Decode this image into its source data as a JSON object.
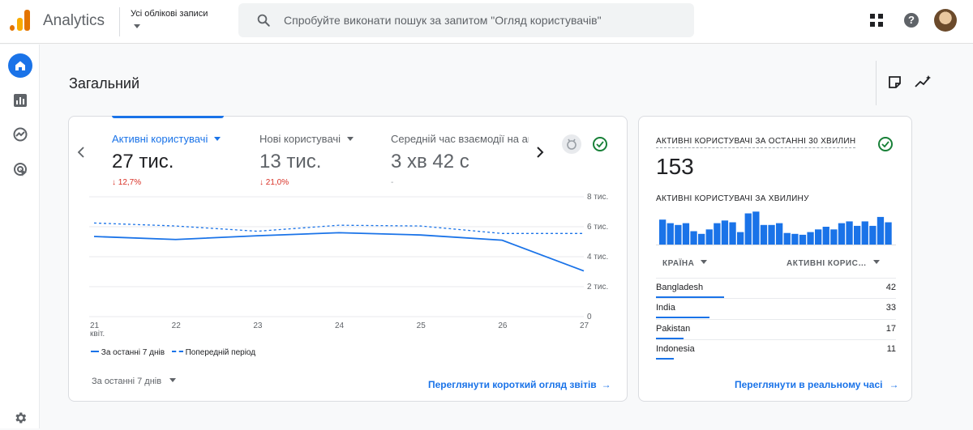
{
  "header": {
    "app_name": "Analytics",
    "account_label": "Усі облікові записи",
    "search_placeholder": "Спробуйте виконати пошук за запитом \"Огляд користувачів\""
  },
  "page": {
    "title": "Загальний"
  },
  "overview": {
    "metrics": [
      {
        "label": "Активні користувачі",
        "value": "27 тис.",
        "delta": "12,7%"
      },
      {
        "label": "Нові користувачі",
        "value": "13 тис.",
        "delta": "21,0%"
      },
      {
        "label": "Середній час взаємодії на ак",
        "value": "3 хв 42 с",
        "delta": "-"
      }
    ],
    "legend_current": "За останні 7 днів",
    "legend_previous": "Попередній період",
    "date_range": "За останні 7 днів",
    "link": "Переглянути короткий огляд звітів"
  },
  "chart_data": {
    "type": "line",
    "x": [
      "21",
      "22",
      "23",
      "24",
      "25",
      "26",
      "27"
    ],
    "x_sublabel": "квіт.",
    "y_ticks": [
      "0",
      "2 тис.",
      "4 тис.",
      "6 тис.",
      "8 тис."
    ],
    "ylim": [
      0,
      8000
    ],
    "series": [
      {
        "name": "За останні 7 днів",
        "style": "solid",
        "values": [
          5350,
          5150,
          5400,
          5600,
          5450,
          5100,
          3050
        ]
      },
      {
        "name": "Попередній період",
        "style": "dashed",
        "values": [
          6250,
          6050,
          5700,
          6100,
          6050,
          5550,
          5550
        ]
      }
    ],
    "color": "#1a73e8",
    "grid": true
  },
  "realtime": {
    "title": "АКТИВНІ КОРИСТУВАЧІ ЗА ОСТАННІ 30 ХВИЛИН",
    "value": "153",
    "per_minute_label": "АКТИВНІ КОРИСТУВАЧІ ЗА ХВИЛИНУ",
    "per_minute": [
      28,
      24,
      22,
      24,
      15,
      12,
      17,
      24,
      27,
      25,
      14,
      35,
      37,
      22,
      22,
      24,
      13,
      12,
      11,
      14,
      17,
      20,
      17,
      24,
      26,
      21,
      26,
      21,
      31,
      25
    ],
    "col_country": "КРАЇНА",
    "col_users": "АКТИВНІ КОРИС…",
    "rows": [
      {
        "country": "Bangladesh",
        "users": "42",
        "share": 1.0
      },
      {
        "country": "India",
        "users": "33",
        "share": 0.79
      },
      {
        "country": "Pakistan",
        "users": "17",
        "share": 0.4
      },
      {
        "country": "Indonesia",
        "users": "11",
        "share": 0.26
      }
    ],
    "link": "Переглянути в реальному часі"
  }
}
